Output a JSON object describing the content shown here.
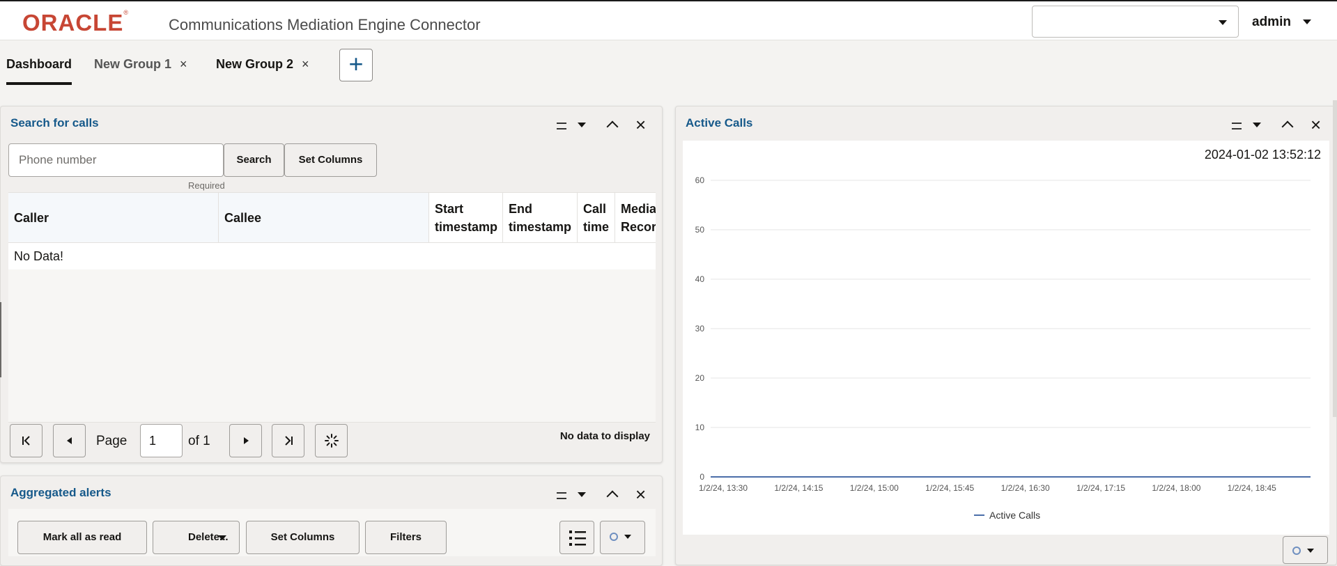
{
  "header": {
    "logo_text": "ORACLE",
    "logo_reg": "®",
    "app_title": "Communications Mediation Engine Connector",
    "top_select_value": "",
    "user": "admin"
  },
  "tabs": [
    {
      "label": "Dashboard",
      "active": true,
      "closable": false
    },
    {
      "label": "New Group 1",
      "active": false,
      "closable": true
    },
    {
      "label": "New Group 2",
      "active": false,
      "closable": true
    }
  ],
  "tab_close_glyph": "×",
  "add_tab_glyph": "+",
  "search_panel": {
    "title": "Search for calls",
    "input_placeholder": "Phone number",
    "search_label": "Search",
    "set_columns_label": "Set Columns",
    "required_text": "Required",
    "columns": [
      "Caller",
      "Callee",
      "Start\ntimestamp",
      "End\ntimestamp",
      "Call\ntime",
      "Media\nRecor"
    ],
    "empty_text": "No Data!",
    "pager": {
      "page_label": "Page",
      "page_value": "1",
      "of_label": "of",
      "total_pages": "1",
      "status": "No data to display"
    }
  },
  "active_calls": {
    "title": "Active Calls",
    "timestamp": "2024-01-02 13:52:12"
  },
  "alerts_panel": {
    "title": "Aggregated alerts",
    "mark_all_label": "Mark all as read",
    "delete_label": "Delete...",
    "set_columns_label": "Set Columns",
    "filters_label": "Filters"
  },
  "colors": {
    "brand_red": "#c74634",
    "link_blue": "#16598a",
    "series_blue": "#4b6ea9",
    "grid": "#e6e6e6"
  },
  "icons": {
    "tab_close": "close-icon",
    "add_tab": "plus-icon",
    "panel_minimize": "minimize-icon",
    "panel_menu": "chevron-down-icon",
    "panel_collapse": "chevron-up-icon",
    "panel_close": "close-icon",
    "pager_first": "first-page-icon",
    "pager_prev": "previous-page-icon",
    "pager_next": "next-page-icon",
    "pager_last": "last-page-icon",
    "pager_refresh": "refresh-icon",
    "view_list": "list-view-icon",
    "view_menu": "settings-icon"
  },
  "chart_data": {
    "type": "line",
    "title": "",
    "x": [
      "1/2/24, 13:30",
      "1/2/24, 14:15",
      "1/2/24, 15:00",
      "1/2/24, 15:45",
      "1/2/24, 16:30",
      "1/2/24, 17:15",
      "1/2/24, 18:00",
      "1/2/24, 18:45"
    ],
    "series": [
      {
        "name": "Active Calls",
        "values": [
          0,
          0,
          0,
          0,
          0,
          0,
          0,
          0
        ]
      }
    ],
    "yticks": [
      0,
      10,
      20,
      30,
      40,
      50,
      60
    ],
    "ylim": [
      0,
      60
    ],
    "xlabel": "",
    "ylabel": "",
    "grid": true,
    "legend": "bottom-center"
  }
}
